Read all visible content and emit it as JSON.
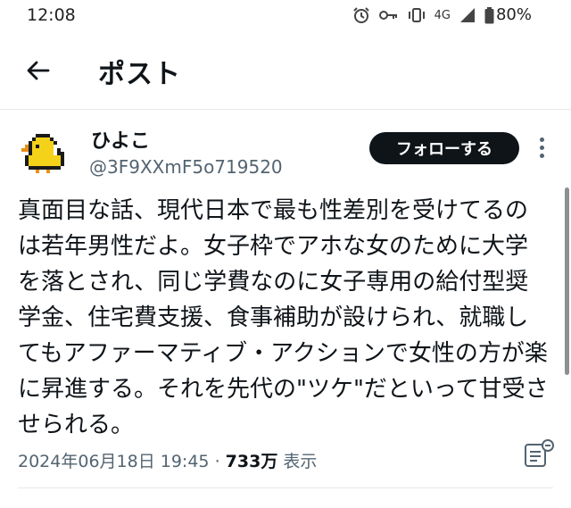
{
  "status_bar": {
    "time": "12:08",
    "network": "4G",
    "battery": "80%"
  },
  "header": {
    "title": "ポスト",
    "back_icon": "arrow-left-icon"
  },
  "post": {
    "display_name": "ひよこ",
    "handle": "@3F9XXmF5o719520",
    "follow_label": "フォローする",
    "text": "真面目な話、現代日本で最も性差別を受けてるのは若年男性だよ。女子枠でアホな女のために大学を落とされ、同じ学費なのに女子専用の給付型奨学金、住宅費支援、食事補助が設けられ、就職してもアファーマティブ・アクションで女性の方が楽に昇進する。それを先代の\"ツケ\"だといって甘受させられる。",
    "timestamp": "2024年06月18日 19:45",
    "separator": "·",
    "views_count": "733万",
    "views_label": "表示"
  },
  "colors": {
    "text": "#0f1419",
    "secondary_text": "#536471",
    "follow_button_bg": "#0f1419",
    "avatar_yellow": "#f5d21a"
  }
}
